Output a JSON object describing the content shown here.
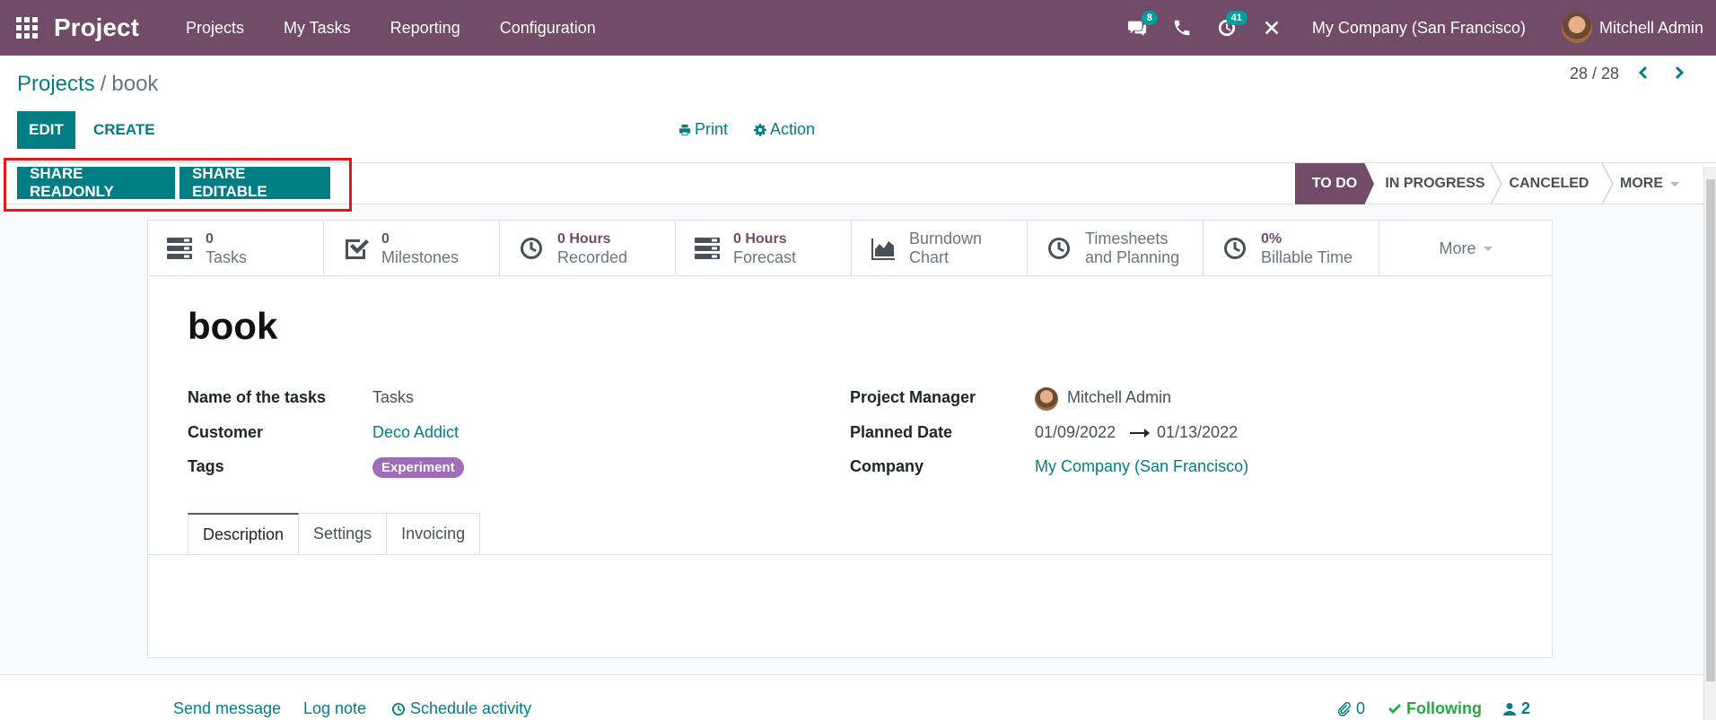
{
  "navbar": {
    "brand": "Project",
    "menu": [
      "Projects",
      "My Tasks",
      "Reporting",
      "Configuration"
    ],
    "messages_badge": "8",
    "activities_badge": "41",
    "company": "My Company (San Francisco)",
    "user": "Mitchell Admin"
  },
  "breadcrumb": {
    "parent": "Projects",
    "separator": "/",
    "current": "book"
  },
  "toolbar": {
    "edit_label": "EDIT",
    "create_label": "CREATE",
    "print_label": "Print",
    "action_label": "Action",
    "pager": "28 / 28"
  },
  "status_actions": {
    "share_readonly": "SHARE READONLY",
    "share_editable": "SHARE EDITABLE"
  },
  "stages": {
    "todo": "TO DO",
    "in_progress": "IN PROGRESS",
    "canceled": "CANCELED",
    "more": "MORE"
  },
  "smart_buttons": [
    {
      "value": "0",
      "label": "Tasks",
      "icon": "tasks-icon"
    },
    {
      "value": "0",
      "label": "Milestones",
      "icon": "check-square-icon"
    },
    {
      "value": "0 Hours",
      "label": "Recorded",
      "icon": "clock-icon"
    },
    {
      "value": "0 Hours",
      "label": "Forecast",
      "icon": "tasks-icon"
    },
    {
      "label1": "Burndown",
      "label2": "Chart",
      "icon": "area-chart-icon"
    },
    {
      "label1": "Timesheets",
      "label2": "and Planning",
      "icon": "clock-icon"
    },
    {
      "value": "0%",
      "label": "Billable Time",
      "icon": "clock-icon"
    }
  ],
  "smart_more": "More",
  "form": {
    "title": "book",
    "name_of_tasks_label": "Name of the tasks",
    "name_of_tasks": "Tasks",
    "customer_label": "Customer",
    "customer": "Deco Addict",
    "tags_label": "Tags",
    "tag": "Experiment",
    "manager_label": "Project Manager",
    "manager": "Mitchell Admin",
    "planned_label": "Planned Date",
    "planned_start": "01/09/2022",
    "planned_end": "01/13/2022",
    "company_label": "Company",
    "company": "My Company (San Francisco)"
  },
  "tabs": [
    "Description",
    "Settings",
    "Invoicing"
  ],
  "chatter": {
    "send_message": "Send message",
    "log_note": "Log note",
    "schedule_activity": "Schedule activity",
    "attachments": "0",
    "following": "Following",
    "followers": "2"
  },
  "colors": {
    "navbar": "#714b67",
    "primary": "#017e84",
    "highlight": "#e0171c",
    "tag": "#a06bb8"
  }
}
